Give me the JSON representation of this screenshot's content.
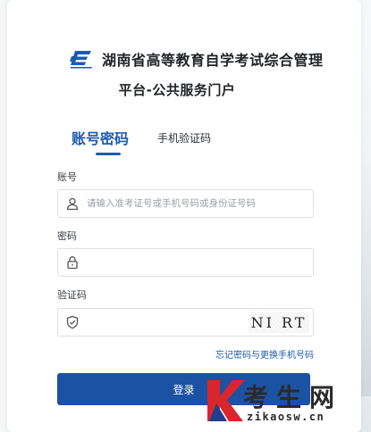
{
  "header": {
    "title_line1": "湖南省高等教育自学考试综合管理",
    "title_line2": "平台-公共服务门户",
    "logo_icon": "exam-logo-icon"
  },
  "tabs": [
    {
      "label": "账号密码",
      "active": true
    },
    {
      "label": "手机验证码",
      "active": false
    }
  ],
  "form": {
    "account": {
      "label": "账号",
      "placeholder": "请输入准考证号或手机号码或身份证号码",
      "value": "",
      "icon": "user-icon"
    },
    "password": {
      "label": "密码",
      "placeholder": "",
      "value": "",
      "icon": "lock-icon"
    },
    "captcha": {
      "label": "验证码",
      "placeholder": "",
      "value": "",
      "icon": "shield-check-icon",
      "image_text": "NI RT"
    }
  },
  "links": {
    "forgot": "忘记密码与更换手机号码"
  },
  "buttons": {
    "login": "登录"
  },
  "watermark": {
    "text": "考生网",
    "domain": "zikaosw.cn"
  },
  "colors": {
    "primary": "#1c5ab0",
    "button": "#1c52a4",
    "watermark_red": "#d9262c",
    "watermark_blue": "#1f3f8f"
  }
}
